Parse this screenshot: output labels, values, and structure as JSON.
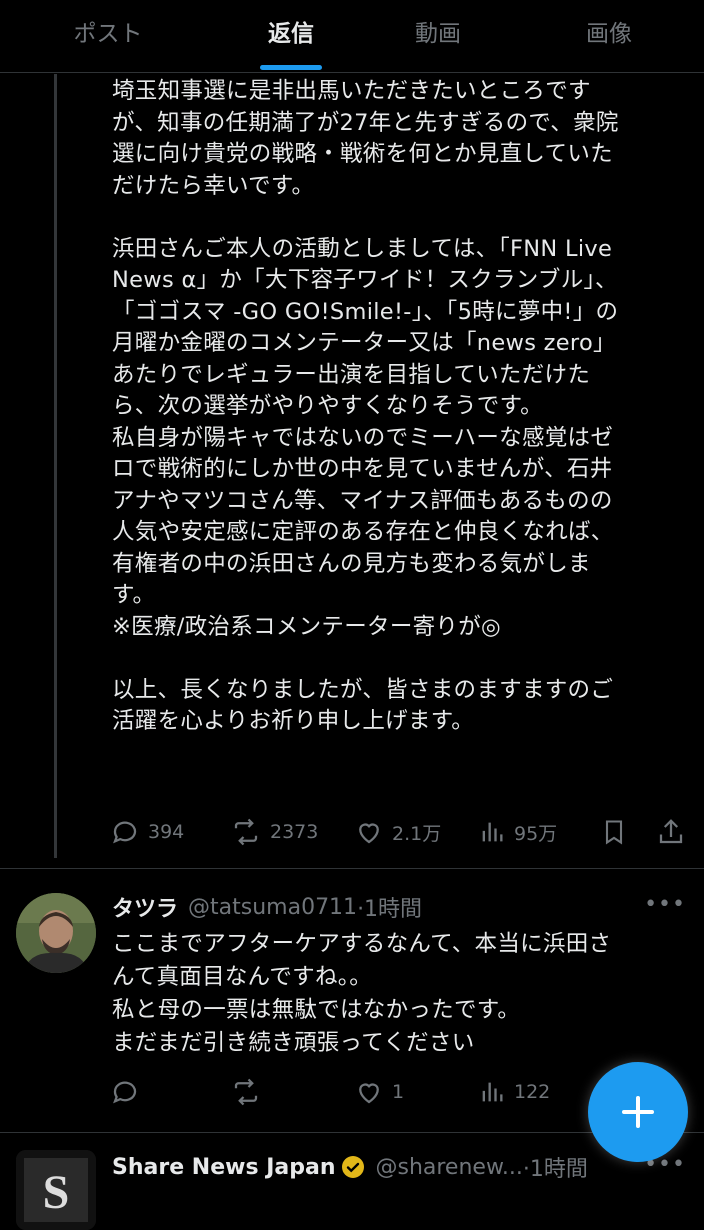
{
  "tabs": [
    {
      "label": "ポスト"
    },
    {
      "label": "返信"
    },
    {
      "label": "動画"
    },
    {
      "label": "画像"
    }
  ],
  "active_tab": "返信",
  "post": {
    "text": "埼玉知事選に是非出馬いただきたいところです\nが、知事の任期満了が27年と先すぎるので、衆院\n選に向け貴党の戦略・戦術を何とか見直していた\nだけたら幸いです。\n\n浜田さんご本人の活動としましては、「FNN Live\nNews α」か「大下容子ワイド！スクランブル」、\n「ゴゴスマ -GO GO!Smile!-」、「5時に夢中!」の\n月曜か金曜のコメンテーター又は「news zero」\nあたりでレギュラー出演を目指していただけた\nら、次の選挙がやりやすくなりそうです。\n私自身が陽キャではないのでミーハーな感覚はゼ\nロで戦術的にしか世の中を見ていませんが、石井\nアナやマツコさん等、マイナス評価もあるものの\n人気や安定感に定評のある存在と仲良くなれば、\n有権者の中の浜田さんの見方も変わる気がしま\nす。\n※医療/政治系コメンテーター寄りが◎\n\n以上、長くなりましたが、皆さまのますますのご\n活躍を心よりお祈り申し上げます。",
    "replies": "394",
    "reposts": "2373",
    "likes": "2.1万",
    "views": "95万"
  },
  "reply": {
    "name": "タツラ",
    "handle": "@tatsuma0711",
    "time": "·1時間",
    "text": "ここまでアフターケアするなんて、本当に浜田さ\nんて真面目なんですね。。\n私と母の一票は無駄ではなかったです。\nまだまだ引き続き頑張ってください",
    "replies": "",
    "reposts": "",
    "likes": "1",
    "views": "122"
  },
  "next_post": {
    "name": "Share News Japan",
    "handle": "@sharenew...",
    "time": "·1時間",
    "avatar_letter": "S"
  },
  "colors": {
    "accent": "#1d9bf0",
    "verified": "#e2b719",
    "muted": "#71767b"
  },
  "icons": [
    "reply-icon",
    "repost-icon",
    "like-icon",
    "views-icon",
    "bookmark-icon",
    "share-icon",
    "more-icon",
    "compose-icon"
  ]
}
